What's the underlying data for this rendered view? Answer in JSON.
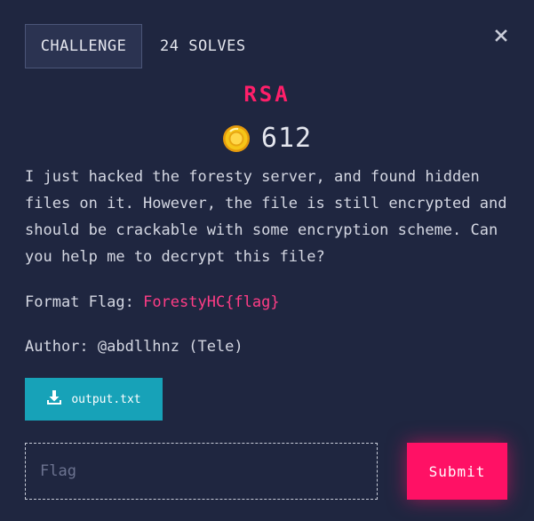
{
  "tabs": {
    "challenge_label": "CHALLENGE",
    "solves_label": "24 SOLVES"
  },
  "challenge": {
    "title": "RSA",
    "points": "612",
    "description": "I just hacked the foresty server, and found hidden files on it. However, the file is still encrypted and should be crackable with some encryption scheme. Can you help me to decrypt this file?",
    "flag_format_label": "Format Flag:",
    "flag_format_value": "ForestyHC{flag}",
    "author": "Author: @abdllhnz (Tele)"
  },
  "file": {
    "name": "output.txt",
    "icon": "download-icon"
  },
  "submission": {
    "placeholder": "Flag",
    "value": "",
    "submit_label": "Submit"
  },
  "colors": {
    "background": "#1f2640",
    "accent": "#ff1165",
    "file_button": "#17a2b8",
    "coin": "#f5c518"
  },
  "icons": {
    "close": "close-icon",
    "coin": "coin-icon"
  }
}
